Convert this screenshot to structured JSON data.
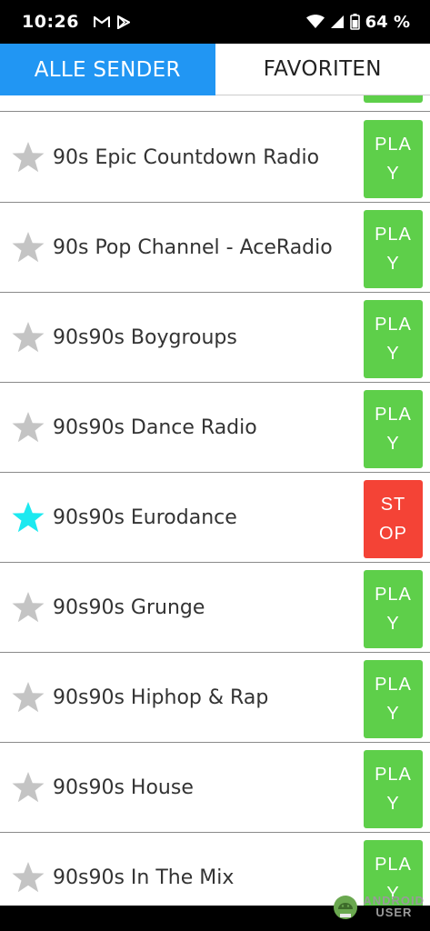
{
  "status_bar": {
    "time": "10:26",
    "notification_icons": [
      "gmail-icon",
      "play-store-icon"
    ],
    "battery_percent": "64 %"
  },
  "tabs": [
    {
      "label": "ALLE SENDER",
      "active": true
    },
    {
      "label": "FAVORITEN",
      "active": false
    }
  ],
  "stations": [
    {
      "name": "90s Epic Countdown Radio",
      "favorite": false,
      "button_top": "PLA",
      "button_bottom": "Y",
      "state": "play"
    },
    {
      "name": "90s Pop Channel - AceRadio",
      "favorite": false,
      "button_top": "PLA",
      "button_bottom": "Y",
      "state": "play"
    },
    {
      "name": "90s90s Boygroups",
      "favorite": false,
      "button_top": "PLA",
      "button_bottom": "Y",
      "state": "play"
    },
    {
      "name": "90s90s Dance Radio",
      "favorite": false,
      "button_top": "PLA",
      "button_bottom": "Y",
      "state": "play"
    },
    {
      "name": "90s90s Eurodance",
      "favorite": true,
      "button_top": "ST",
      "button_bottom": "OP",
      "state": "stop"
    },
    {
      "name": "90s90s Grunge",
      "favorite": false,
      "button_top": "PLA",
      "button_bottom": "Y",
      "state": "play"
    },
    {
      "name": "90s90s Hiphop & Rap",
      "favorite": false,
      "button_top": "PLA",
      "button_bottom": "Y",
      "state": "play"
    },
    {
      "name": "90s90s House",
      "favorite": false,
      "button_top": "PLA",
      "button_bottom": "Y",
      "state": "play"
    },
    {
      "name": "90s90s In The Mix",
      "favorite": false,
      "button_top": "PLA",
      "button_bottom": "Y",
      "state": "play"
    }
  ],
  "colors": {
    "tab_active": "#2196f3",
    "play": "#5ecf4a",
    "stop": "#f44336",
    "star_off": "#c4c4c4",
    "star_on": "#1de9f0"
  },
  "watermark": {
    "line1": "ANDROID",
    "line2": "USER"
  }
}
